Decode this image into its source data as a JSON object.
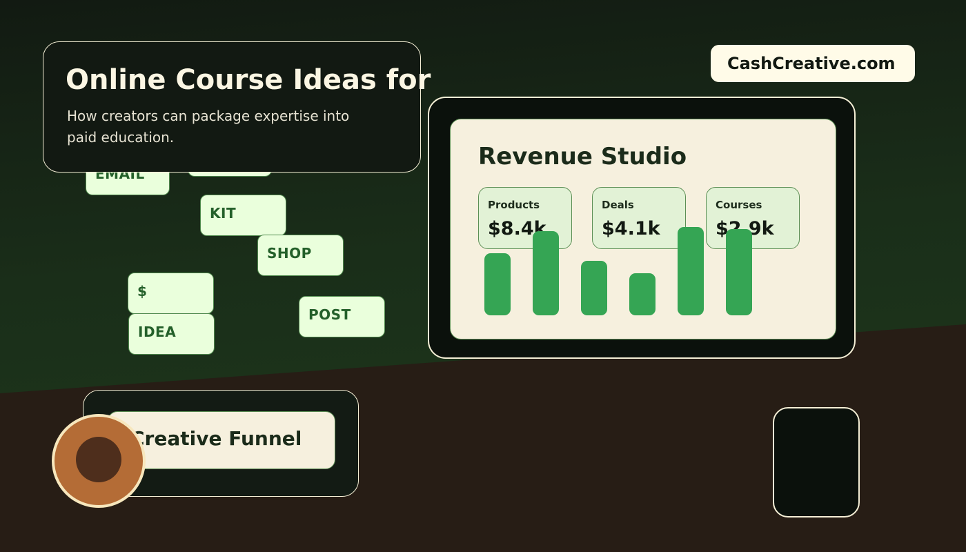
{
  "title": {
    "heading": "Online Course Ideas for",
    "subtitle": "How creators can package expertise into paid education."
  },
  "brand": {
    "label": "CashCreative.com"
  },
  "tags": [
    "EMAIL",
    "KIT",
    "SHOP",
    "$",
    "IDEA",
    "POST"
  ],
  "dashboard": {
    "title": "Revenue Studio",
    "metrics": [
      {
        "label": "Products",
        "value": "$8.4k"
      },
      {
        "label": "Deals",
        "value": "$4.1k"
      },
      {
        "label": "Courses",
        "value": "$2.9k"
      }
    ],
    "bar_levels": [
      0.7,
      0.95,
      0.62,
      0.48,
      1.0,
      0.98
    ]
  },
  "funnel": {
    "label": "Creative Funnel"
  },
  "colors": {
    "bar": "#35a554",
    "accent_cream": "#f5efd6",
    "floor": "#271d15"
  }
}
